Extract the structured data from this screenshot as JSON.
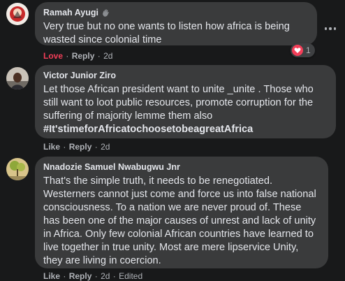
{
  "comments": [
    {
      "author": "Ramah Ayugi",
      "badge_icon": "hand-wave-icon",
      "text": "Very true but no one wants to listen how africa is being wasted since colonial time",
      "actions": {
        "like_label": "Love",
        "reply_label": "Reply",
        "time": "2d"
      },
      "reaction": {
        "icon": "heart-icon",
        "count": "1"
      }
    },
    {
      "author": "Victor Junior Ziro",
      "text": "Let those African president want to unite _unite . Those who still want to loot public resources, promote corruption for the suffering of majority lemme them also ",
      "hashtag": "#It'stimeforAfricatochoosetobeagreatAfrica",
      "actions": {
        "like_label": "Like",
        "reply_label": "Reply",
        "time": "2d"
      }
    },
    {
      "author": "Nnadozie Samuel Nwabugwu Jnr",
      "text": "That's the simple truth, it needs to be renegotiated. Westerners cannot just come and force us into false national consciousness. To a nation we are never proud of. These has been one of the major causes of unrest and lack of unity in Africa. Only few colonial African countries have learned to live together in true unity. Most are mere lipservice Unity, they are living in coercion.",
      "actions": {
        "like_label": "Like",
        "reply_label": "Reply",
        "time": "2d",
        "edited": "Edited"
      }
    }
  ],
  "colors": {
    "background": "#18191a",
    "bubble": "#3a3b3c",
    "love": "#f33e58",
    "muted": "#b0b3b8"
  },
  "more_icon": "more-options-icon"
}
